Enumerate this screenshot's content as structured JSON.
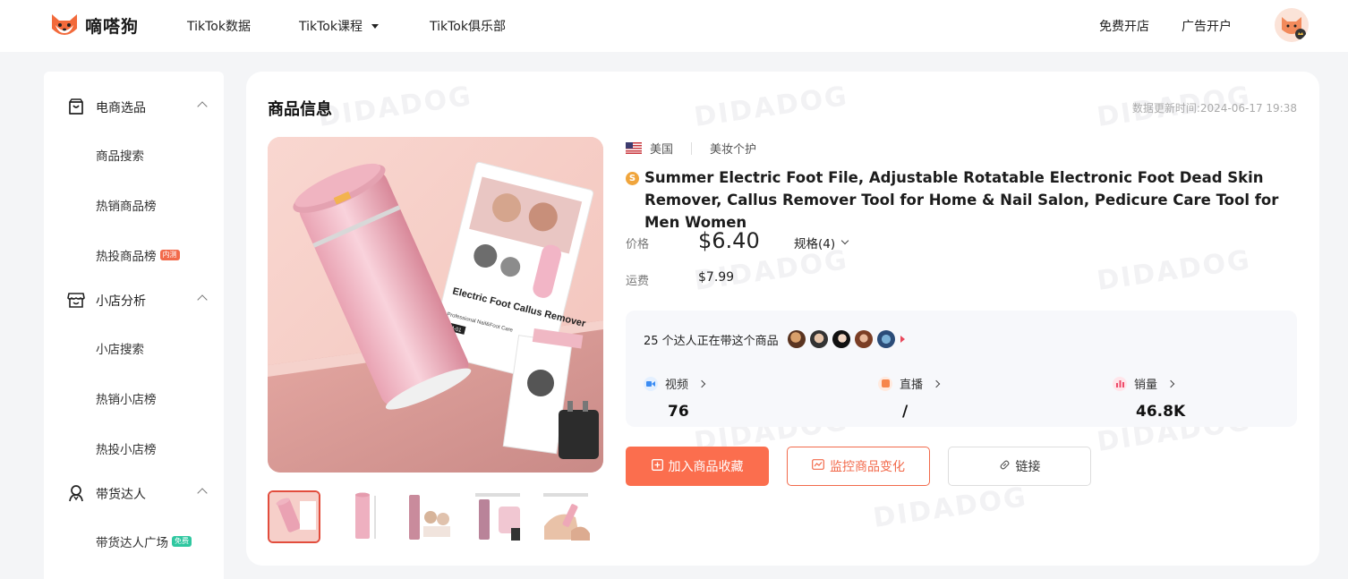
{
  "brand": {
    "name": "嘀嗒狗"
  },
  "nav": {
    "items": [
      {
        "label": "TikTok数据"
      },
      {
        "label": "TikTok课程"
      },
      {
        "label": "TikTok俱乐部"
      }
    ],
    "right": [
      {
        "label": "免费开店"
      },
      {
        "label": "广告开户"
      }
    ]
  },
  "sidebar": {
    "groups": [
      {
        "label": "电商选品",
        "icon": "shopping-bag-icon",
        "items": [
          {
            "label": "商品搜索"
          },
          {
            "label": "热销商品榜"
          },
          {
            "label": "热投商品榜",
            "tag": "内测"
          }
        ]
      },
      {
        "label": "小店分析",
        "icon": "shop-icon",
        "items": [
          {
            "label": "小店搜索"
          },
          {
            "label": "热销小店榜"
          },
          {
            "label": "热投小店榜"
          }
        ]
      },
      {
        "label": "带货达人",
        "icon": "person-icon",
        "items": [
          {
            "label": "带货达人广场",
            "tag": "免费"
          }
        ]
      }
    ]
  },
  "product": {
    "section_title": "商品信息",
    "update_time": "数据更新时间:2024-06-17 19:38",
    "region": "美国",
    "category": "美妆个护",
    "title": "Summer Electric Foot File, Adjustable Rotatable Electronic Foot Dead Skin Remover, Callus Remover Tool for Home & Nail Salon, Pedicure Care Tool for Men Women",
    "price_label": "价格",
    "price": "$6.40",
    "spec_label": "规格(4)",
    "shipping_label": "运费",
    "shipping": "$7.99",
    "box_text": "Electric Foot Callus Remover",
    "box_subtext": "Professional Nail&Foot Care",
    "box_model": "CM-01"
  },
  "stats": {
    "kol_text": "25 个达人正在带这个商品",
    "videos_label": "视频",
    "videos_value": "76",
    "live_label": "直播",
    "live_value": "/",
    "sales_label": "销量",
    "sales_value": "46.8K"
  },
  "actions": {
    "favorite": "加入商品收藏",
    "monitor": "监控商品变化",
    "link": "链接"
  },
  "watermark": "DIDADOG",
  "colors": {
    "accent": "#fb6e4e",
    "sidebar_tag_new": "#f26a4b",
    "sidebar_tag_free": "#2fc7a0"
  }
}
